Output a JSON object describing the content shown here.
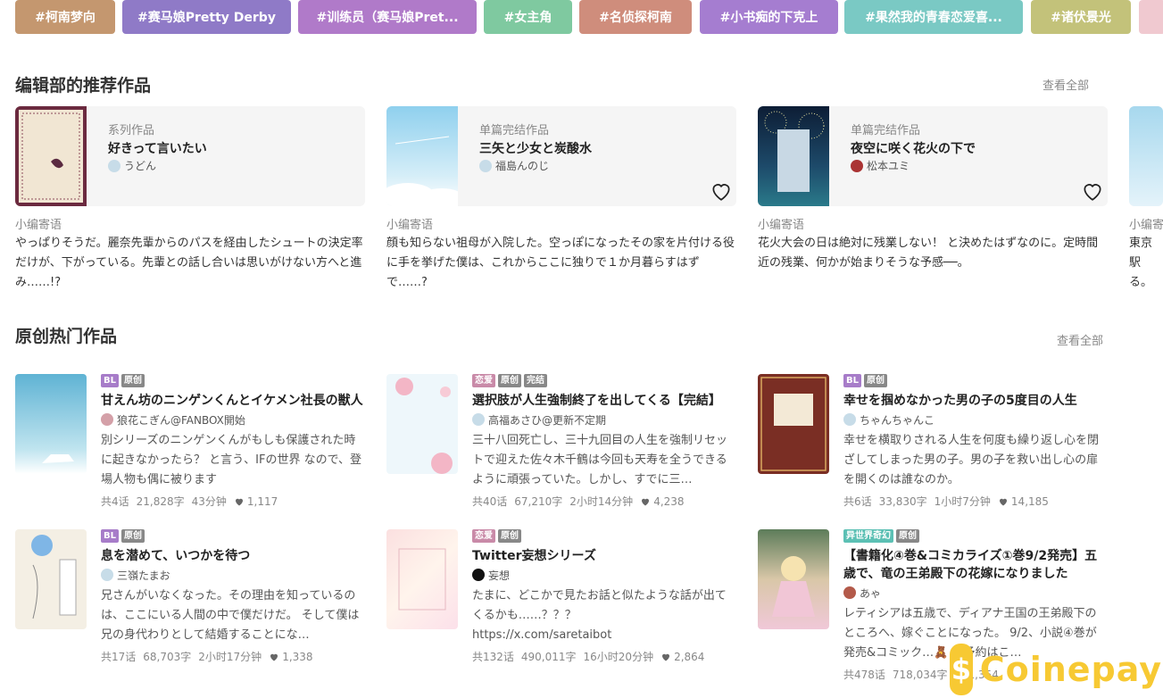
{
  "tags": [
    {
      "label": "#柯南梦向",
      "color": "#c4976f"
    },
    {
      "label": "#赛马娘Pretty Derby",
      "color": "#8f7ac7"
    },
    {
      "label": "#训练员（赛马娘Pret...",
      "color": "#b07ac9"
    },
    {
      "label": "#女主角",
      "color": "#7fc9a0"
    },
    {
      "label": "#名侦探柯南",
      "color": "#cf8d7c"
    },
    {
      "label": "#小书痴的下克上",
      "color": "#a57dd0"
    },
    {
      "label": "#果然我的青春恋爱喜...",
      "color": "#7ac9c4"
    },
    {
      "label": "#诸伏景光",
      "color": "#c3c27a"
    },
    {
      "label": "",
      "color": "#f0c9d0"
    }
  ],
  "editors": {
    "title": "编辑部的推荐作品",
    "see_all": "查看全部",
    "cards": [
      {
        "type": "系列作品",
        "title": "好きって言いたい",
        "author": "うどん",
        "note_label": "小编寄语",
        "note": "やっぱりそうだ。麗奈先輩からのパスを経由したシュートの決定率だけが、下がっている。先輩との話し合いは思いがけない方へと進み……!?",
        "cover": "#6b2a3f"
      },
      {
        "type": "单篇完结作品",
        "title": "三矢と少女と炭酸水",
        "author": "福島んのじ",
        "note_label": "小编寄语",
        "note": "顔も知らない祖母が入院した。空っぽになったその家を片付ける役に手を挙げた僕は、これからここに独りで１か月暮らすはずで……?",
        "cover": "#9fd4ec"
      },
      {
        "type": "单篇完结作品",
        "title": "夜空に咲く花火の下で",
        "author": "松本ユミ",
        "note_label": "小编寄语",
        "note": "花火大会の日は絶対に残業しない！ と決めたはずなのに。定時間近の残業、何かが始まりそうな予感──。",
        "cover": "#1d3a5c"
      },
      {
        "type": "",
        "title": "",
        "author": "",
        "note_label": "小编寄",
        "note": "東京駅る。あた。",
        "cover": "#bfe3f2"
      }
    ]
  },
  "popular": {
    "title": "原创热门作品",
    "see_all": "查看全部",
    "works": [
      {
        "badges": [
          {
            "t": "BL",
            "c": "#a77cc9"
          },
          {
            "t": "原创",
            "c": "#888"
          }
        ],
        "title": "甘えん坊のニンゲンくんとイケメン社長の獣人",
        "author": "狼花こぎん@FANBOX開始",
        "desc": "別シリーズのニンゲンくんがもしも保護された時に起きなかったら？ と言う、IFの世界 なので、登場人物も偶に被ります",
        "stats": [
          "共4话",
          "21,828字",
          "43分钟"
        ],
        "likes": "1,117",
        "cover": "#5fb3d4"
      },
      {
        "badges": [
          {
            "t": "恋爱",
            "c": "#c98aa8"
          },
          {
            "t": "原创",
            "c": "#888"
          },
          {
            "t": "完结",
            "c": "#888"
          }
        ],
        "title": "選択肢が人生強制終了を出してくる【完結】",
        "author": "高福あさひ@更新不定期",
        "desc": "三十八回死亡し、三十九回目の人生を強制リセットで迎えた佐々木千鶴は今回も天寿を全うできるように頑張っていた。しかし、すでに三…",
        "stats": [
          "共40话",
          "67,210字",
          "2小时14分钟"
        ],
        "likes": "4,238",
        "cover": "#e9f4fa"
      },
      {
        "badges": [
          {
            "t": "BL",
            "c": "#a77cc9"
          },
          {
            "t": "原创",
            "c": "#888"
          }
        ],
        "title": "幸せを掴めなかった男の子の5度目の人生",
        "author": "ちゃんちゃんこ",
        "desc": "幸せを横取りされる人生を何度も繰り返し心を閉ざしてしまった男の子。男の子を救い出し心の扉を開くのは誰なのか。",
        "stats": [
          "共6话",
          "33,830字",
          "1小时7分钟"
        ],
        "likes": "14,185",
        "cover": "#7a2e24"
      },
      {
        "badges": [
          {
            "t": "BL",
            "c": "#a77cc9"
          },
          {
            "t": "原创",
            "c": "#888"
          }
        ],
        "title": "息を潜めて、いつかを待つ",
        "author": "三嶺たまお",
        "desc": "兄さんがいなくなった。その理由を知っているのは、ここにいる人間の中で僕だけだ。 そして僕は兄の身代わりとして結婚することにな…",
        "stats": [
          "共17话",
          "68,703字",
          "2小时17分钟"
        ],
        "likes": "1,338",
        "cover": "#f3ede2"
      },
      {
        "badges": [
          {
            "t": "恋爱",
            "c": "#c98aa8"
          },
          {
            "t": "原创",
            "c": "#888"
          }
        ],
        "title": "Twitter妄想シリーズ",
        "author": "妄想",
        "desc": "たまに、どこかで見たお話と似たような話が出てくるかも……？？？\nhttps://x.com/saretaibot",
        "stats": [
          "共132话",
          "490,011字",
          "16小时20分钟"
        ],
        "likes": "2,864",
        "cover": "#fbe6e6"
      },
      {
        "badges": [
          {
            "t": "异世界奇幻",
            "c": "#5cc0b4"
          },
          {
            "t": "原创",
            "c": "#888"
          }
        ],
        "title": "【書籍化④巻&コミカライズ①巻9/2発売】五歳で、竜の王弟殿下の花嫁になりました",
        "author": "あゃ",
        "desc": "レティシアは五歳で、ディアナ王国の王弟殿下のところへ、嫁ぐことになった。 9/2、小説④巻が発売&コミック…🧸 ご予約はこ…",
        "stats": [
          "共478话",
          "718,034字"
        ],
        "likes": "1,354",
        "cover": "#d9c7a8"
      }
    ]
  },
  "watermark": {
    "brand": "Coinepay",
    "icon": "money-bag-icon"
  }
}
